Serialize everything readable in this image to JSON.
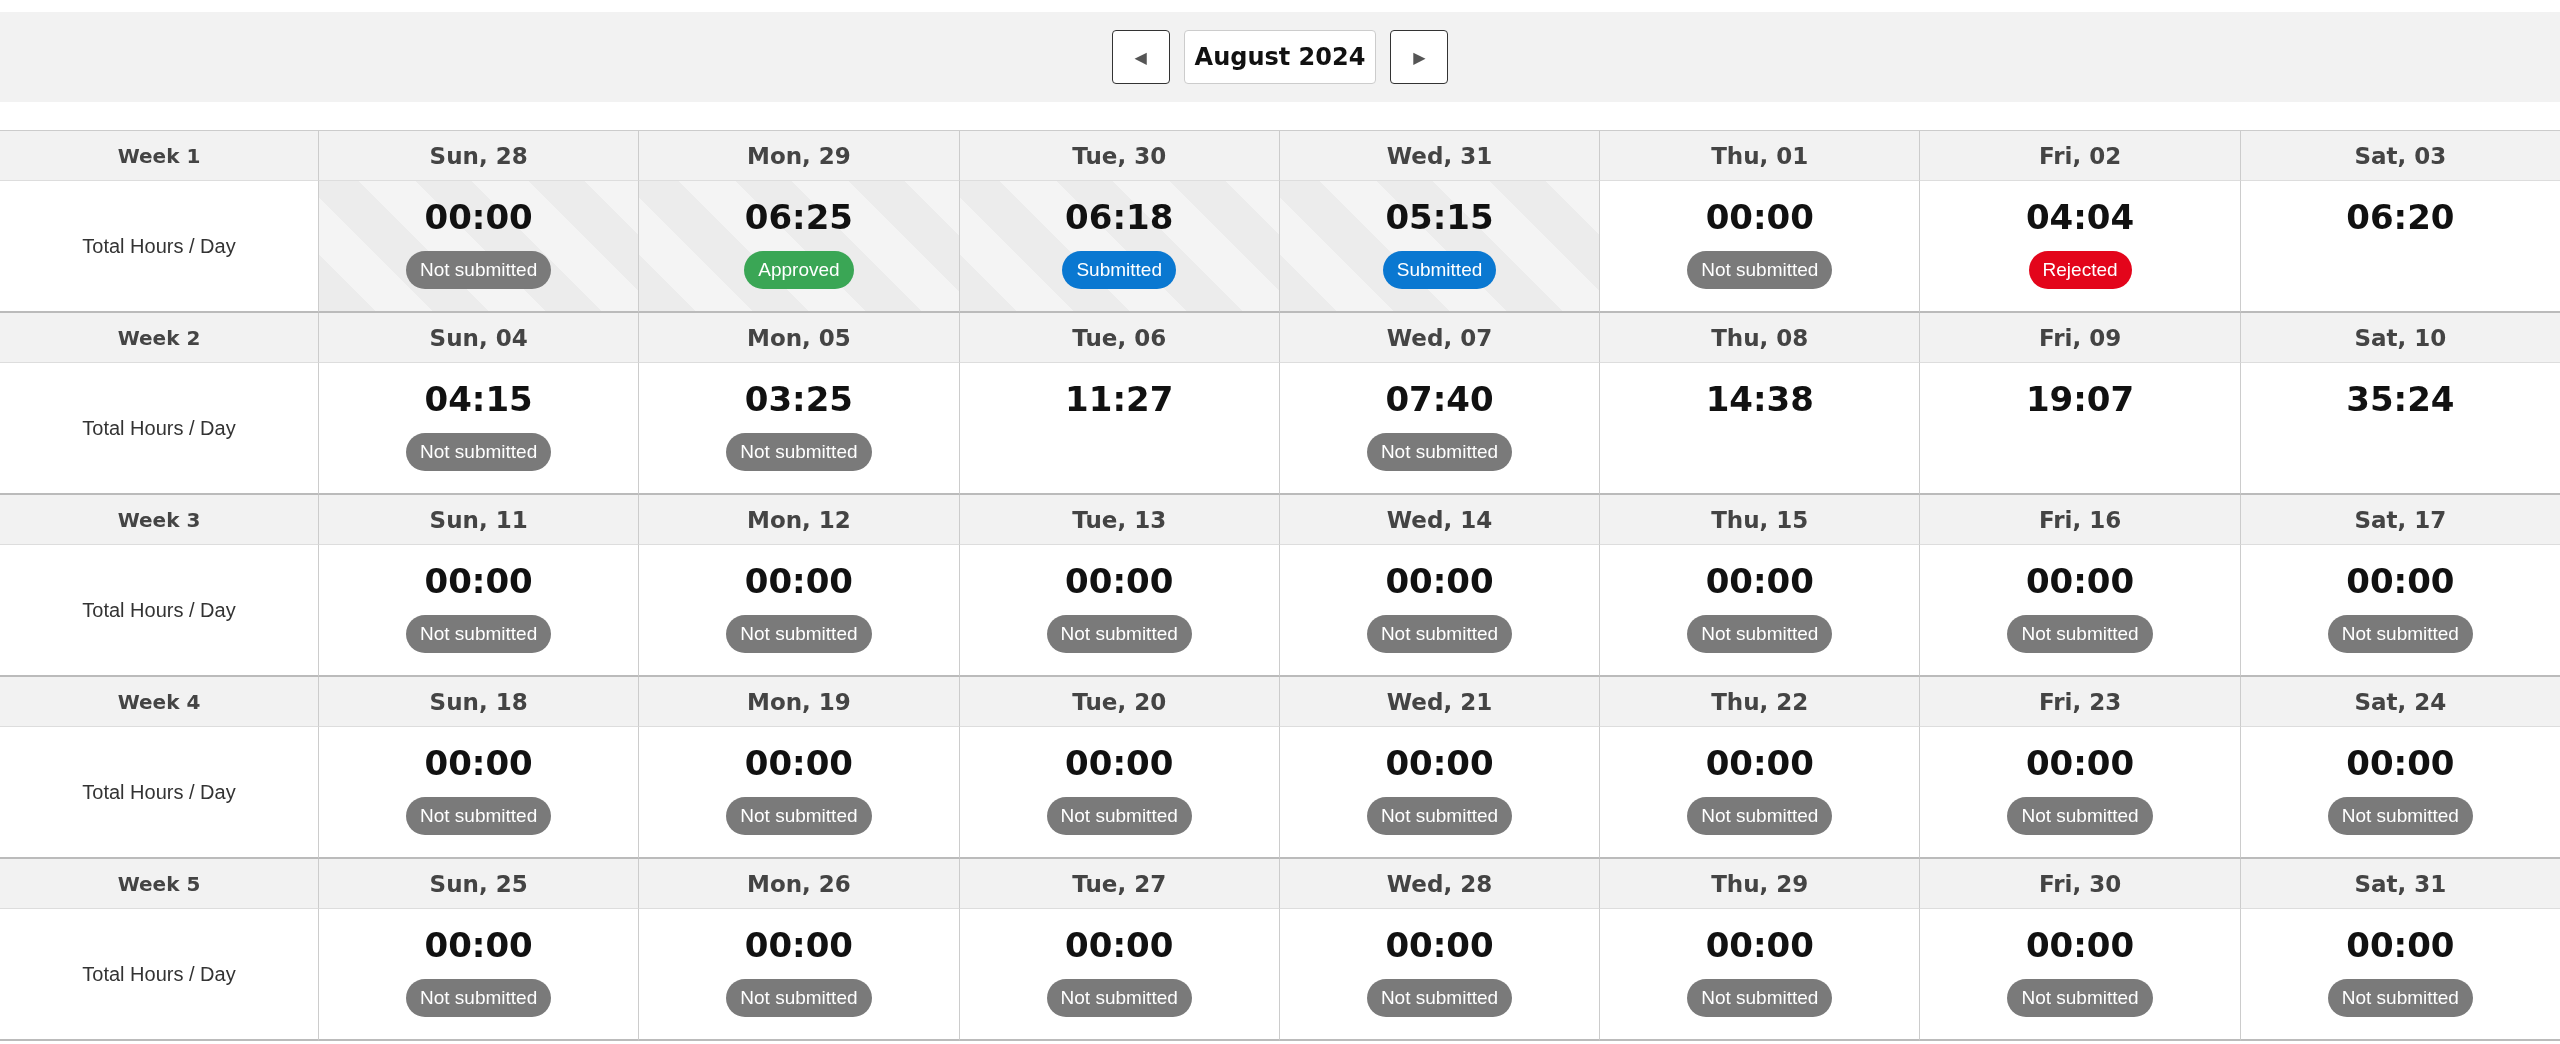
{
  "toolbar": {
    "prev_label": "◀",
    "month": "August 2024",
    "next_label": "▶"
  },
  "weeks": [
    {
      "label": "Week 1",
      "row_label": "Total Hours / Day",
      "days": [
        {
          "date": "Sun, 28",
          "hours": "00:00",
          "striped": true,
          "status": {
            "kind": "not_submitted",
            "label": "Not submitted"
          }
        },
        {
          "date": "Mon, 29",
          "hours": "06:25",
          "striped": true,
          "status": {
            "kind": "approved",
            "label": "Approved"
          }
        },
        {
          "date": "Tue, 30",
          "hours": "06:18",
          "striped": true,
          "status": {
            "kind": "submitted",
            "label": "Submitted"
          }
        },
        {
          "date": "Wed, 31",
          "hours": "05:15",
          "striped": true,
          "status": {
            "kind": "submitted",
            "label": "Submitted"
          }
        },
        {
          "date": "Thu, 01",
          "hours": "00:00",
          "striped": false,
          "status": {
            "kind": "not_submitted",
            "label": "Not submitted"
          }
        },
        {
          "date": "Fri, 02",
          "hours": "04:04",
          "striped": false,
          "status": {
            "kind": "rejected",
            "label": "Rejected"
          }
        },
        {
          "date": "Sat, 03",
          "hours": "06:20",
          "striped": false
        }
      ]
    },
    {
      "label": "Week 2",
      "row_label": "Total Hours / Day",
      "days": [
        {
          "date": "Sun, 04",
          "hours": "04:15",
          "striped": false,
          "status": {
            "kind": "not_submitted",
            "label": "Not submitted"
          }
        },
        {
          "date": "Mon, 05",
          "hours": "03:25",
          "striped": false,
          "status": {
            "kind": "not_submitted",
            "label": "Not submitted"
          }
        },
        {
          "date": "Tue, 06",
          "hours": "11:27",
          "striped": false
        },
        {
          "date": "Wed, 07",
          "hours": "07:40",
          "striped": false,
          "status": {
            "kind": "not_submitted",
            "label": "Not submitted"
          }
        },
        {
          "date": "Thu, 08",
          "hours": "14:38",
          "striped": false
        },
        {
          "date": "Fri, 09",
          "hours": "19:07",
          "striped": false
        },
        {
          "date": "Sat, 10",
          "hours": "35:24",
          "striped": false
        }
      ]
    },
    {
      "label": "Week 3",
      "row_label": "Total Hours / Day",
      "days": [
        {
          "date": "Sun, 11",
          "hours": "00:00",
          "striped": false,
          "status": {
            "kind": "not_submitted",
            "label": "Not submitted"
          }
        },
        {
          "date": "Mon, 12",
          "hours": "00:00",
          "striped": false,
          "status": {
            "kind": "not_submitted",
            "label": "Not submitted"
          }
        },
        {
          "date": "Tue, 13",
          "hours": "00:00",
          "striped": false,
          "status": {
            "kind": "not_submitted",
            "label": "Not submitted"
          }
        },
        {
          "date": "Wed, 14",
          "hours": "00:00",
          "striped": false,
          "status": {
            "kind": "not_submitted",
            "label": "Not submitted"
          }
        },
        {
          "date": "Thu, 15",
          "hours": "00:00",
          "striped": false,
          "status": {
            "kind": "not_submitted",
            "label": "Not submitted"
          }
        },
        {
          "date": "Fri, 16",
          "hours": "00:00",
          "striped": false,
          "status": {
            "kind": "not_submitted",
            "label": "Not submitted"
          }
        },
        {
          "date": "Sat, 17",
          "hours": "00:00",
          "striped": false,
          "status": {
            "kind": "not_submitted",
            "label": "Not submitted"
          }
        }
      ]
    },
    {
      "label": "Week 4",
      "row_label": "Total Hours / Day",
      "days": [
        {
          "date": "Sun, 18",
          "hours": "00:00",
          "striped": false,
          "status": {
            "kind": "not_submitted",
            "label": "Not submitted"
          }
        },
        {
          "date": "Mon, 19",
          "hours": "00:00",
          "striped": false,
          "status": {
            "kind": "not_submitted",
            "label": "Not submitted"
          }
        },
        {
          "date": "Tue, 20",
          "hours": "00:00",
          "striped": false,
          "status": {
            "kind": "not_submitted",
            "label": "Not submitted"
          }
        },
        {
          "date": "Wed, 21",
          "hours": "00:00",
          "striped": false,
          "status": {
            "kind": "not_submitted",
            "label": "Not submitted"
          }
        },
        {
          "date": "Thu, 22",
          "hours": "00:00",
          "striped": false,
          "status": {
            "kind": "not_submitted",
            "label": "Not submitted"
          }
        },
        {
          "date": "Fri, 23",
          "hours": "00:00",
          "striped": false,
          "status": {
            "kind": "not_submitted",
            "label": "Not submitted"
          }
        },
        {
          "date": "Sat, 24",
          "hours": "00:00",
          "striped": false,
          "status": {
            "kind": "not_submitted",
            "label": "Not submitted"
          }
        }
      ]
    },
    {
      "label": "Week 5",
      "row_label": "Total Hours / Day",
      "days": [
        {
          "date": "Sun, 25",
          "hours": "00:00",
          "striped": false,
          "status": {
            "kind": "not_submitted",
            "label": "Not submitted"
          }
        },
        {
          "date": "Mon, 26",
          "hours": "00:00",
          "striped": false,
          "status": {
            "kind": "not_submitted",
            "label": "Not submitted"
          }
        },
        {
          "date": "Tue, 27",
          "hours": "00:00",
          "striped": false,
          "status": {
            "kind": "not_submitted",
            "label": "Not submitted"
          }
        },
        {
          "date": "Wed, 28",
          "hours": "00:00",
          "striped": false,
          "status": {
            "kind": "not_submitted",
            "label": "Not submitted"
          }
        },
        {
          "date": "Thu, 29",
          "hours": "00:00",
          "striped": false,
          "status": {
            "kind": "not_submitted",
            "label": "Not submitted"
          }
        },
        {
          "date": "Fri, 30",
          "hours": "00:00",
          "striped": false,
          "status": {
            "kind": "not_submitted",
            "label": "Not submitted"
          }
        },
        {
          "date": "Sat, 31",
          "hours": "00:00",
          "striped": false,
          "status": {
            "kind": "not_submitted",
            "label": "Not submitted"
          }
        }
      ]
    }
  ]
}
